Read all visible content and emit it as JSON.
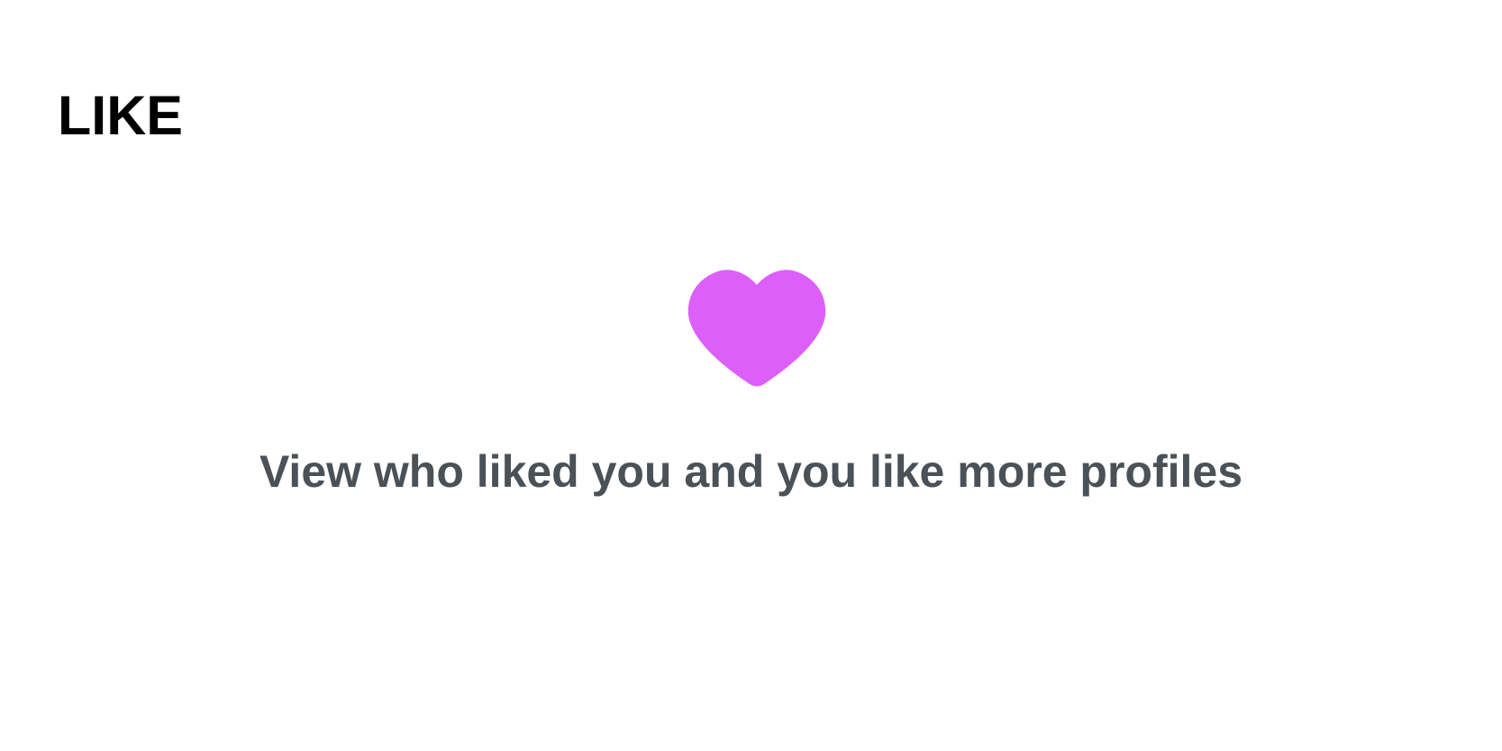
{
  "header": {
    "title": "LIKE"
  },
  "empty_state": {
    "icon": "heart-icon",
    "icon_color": "#dd5ffa",
    "message": "View who liked you and you like more profiles",
    "message_color": "#4a5157"
  }
}
